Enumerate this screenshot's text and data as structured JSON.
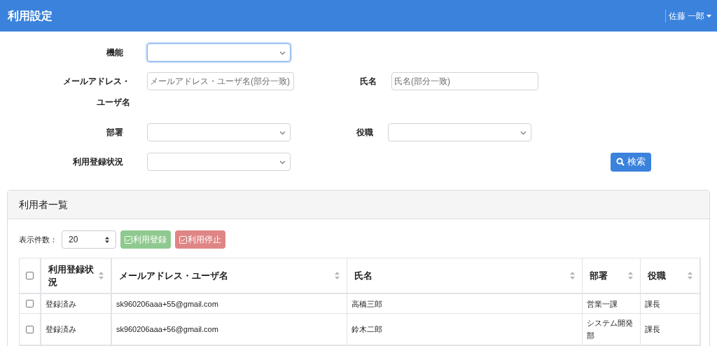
{
  "header": {
    "title": "利用設定",
    "user": "佐藤 一郎"
  },
  "filters": [
    {
      "label": "機能",
      "kind": "select",
      "focused": true
    },
    {
      "label": "メールアドレス・ユーザ名",
      "kind": "text",
      "placeholder": "メールアドレス・ユーザ名(部分一致)"
    },
    {
      "label": "氏名",
      "kind": "text",
      "placeholder": "氏名(部分一致)"
    },
    {
      "label": "部署",
      "kind": "select",
      "focused": false
    },
    {
      "label": "役職",
      "kind": "select",
      "focused": false
    },
    {
      "label": "利用登録状況",
      "kind": "select",
      "focused": false
    }
  ],
  "search_button": "検索",
  "panel": {
    "title": "利用者一覧",
    "page_size_label": "表示件数：",
    "page_size": "20",
    "actions": [
      {
        "label": "利用登録",
        "kind": "register"
      },
      {
        "label": "利用停止",
        "kind": "stop"
      }
    ]
  },
  "table": {
    "select_all_checked": false,
    "columns": [
      "利用登録状況",
      "メールアドレス・ユーザ名",
      "氏名",
      "部署",
      "役職"
    ],
    "rows": [
      {
        "checked": false,
        "cells": [
          "登録済み",
          "sk960206aaa+55@gmail.com",
          "高橋三郎",
          "営業一課",
          "課長"
        ]
      },
      {
        "checked": false,
        "cells": [
          "登録済み",
          "sk960206aaa+56@gmail.com",
          "鈴木二郎",
          "システム開発部",
          "課長"
        ]
      }
    ]
  }
}
